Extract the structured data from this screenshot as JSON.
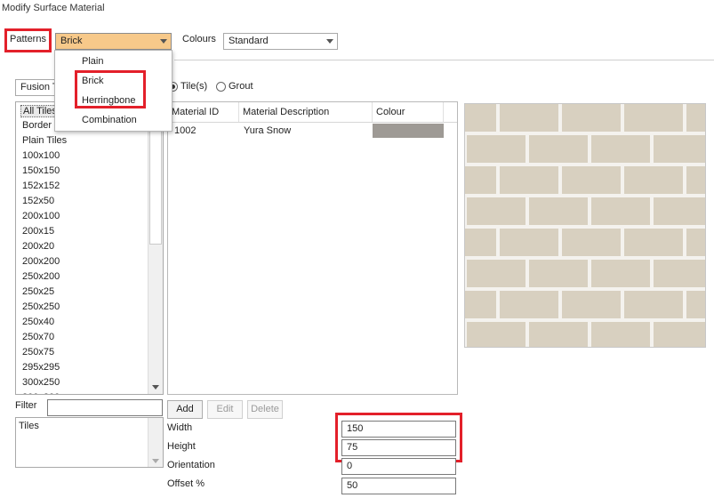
{
  "window": {
    "title": "Modify Surface Material"
  },
  "patterns": {
    "label": "Patterns",
    "selected": "Brick",
    "options": [
      "Plain",
      "Brick",
      "Herringbone",
      "Combination"
    ]
  },
  "colours": {
    "label": "Colours",
    "selected": "Standard"
  },
  "source_combo": {
    "visible_text": "Fusion T"
  },
  "mode_radios": {
    "tiles_label": "Tile(s)",
    "grout_label": "Grout",
    "selected": "tiles"
  },
  "size_list": {
    "items": [
      "All Tiles",
      "Border",
      "Plain Tiles",
      "100x100",
      "150x150",
      "152x152",
      "152x50",
      "200x100",
      "200x15",
      "200x20",
      "200x200",
      "250x200",
      "250x25",
      "250x250",
      "250x40",
      "250x70",
      "250x75",
      "295x295",
      "300x250",
      "300x300"
    ],
    "selected_index": 0
  },
  "materials_grid": {
    "columns": [
      "Material ID",
      "Material Description",
      "Colour"
    ],
    "rows": [
      {
        "id": "1002",
        "description": "Yura Snow",
        "colour": "#9e9a95"
      }
    ]
  },
  "buttons": {
    "add": "Add",
    "edit": "Edit",
    "delete": "Delete"
  },
  "filter": {
    "label": "Filter",
    "value": ""
  },
  "category_list": {
    "items": [
      "Tiles"
    ]
  },
  "dimensions": {
    "width_label": "Width",
    "width_value": "150",
    "height_label": "Height",
    "height_value": "75",
    "orientation_label": "Orientation",
    "orientation_value": "0",
    "offset_label": "Offset %",
    "offset_value": "50"
  },
  "colors": {
    "highlight": "#e3202a",
    "combo_active": "#f7c98a",
    "tile": "#d8d0c0",
    "grout": "#f4f2ee"
  }
}
